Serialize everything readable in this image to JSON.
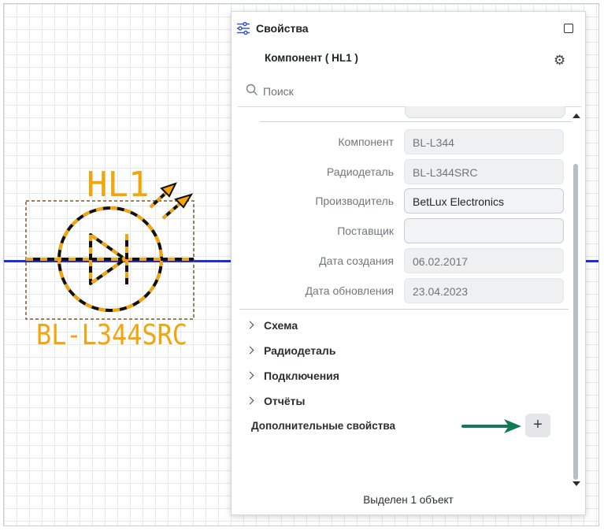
{
  "schematic": {
    "ref": "HL1",
    "part": "BL-L344SRC",
    "colors": {
      "symbol": "#f5a50a",
      "wire": "#1d2fd6",
      "outline": "#7a5a2a"
    }
  },
  "panel": {
    "title": "Свойства",
    "component_title": "Компонент ( HL1 )",
    "search_placeholder": "Поиск",
    "properties": [
      {
        "label": "Компонент",
        "value": "BL-L344",
        "editable": false
      },
      {
        "label": "Радиодеталь",
        "value": "BL-L344SRC",
        "editable": false
      },
      {
        "label": "Производитель",
        "value": "BetLux Electronics",
        "editable": true
      },
      {
        "label": "Поставщик",
        "value": "",
        "editable": true
      },
      {
        "label": "Дата создания",
        "value": "06.02.2017",
        "editable": false
      },
      {
        "label": "Дата обновления",
        "value": "23.04.2023",
        "editable": false
      }
    ],
    "sections": [
      {
        "label": "Схема"
      },
      {
        "label": "Радиодеталь"
      },
      {
        "label": "Подключения"
      },
      {
        "label": "Отчёты"
      }
    ],
    "extra_properties_label": "Дополнительные свойства",
    "add_button_label": "+",
    "status": "Выделен 1 объект",
    "icons": {
      "settings": "gear-icon",
      "search": "search-icon",
      "panel": "sliders-icon",
      "maximize": "maximize-icon"
    },
    "accent_arrow_color": "#0f7a55"
  }
}
